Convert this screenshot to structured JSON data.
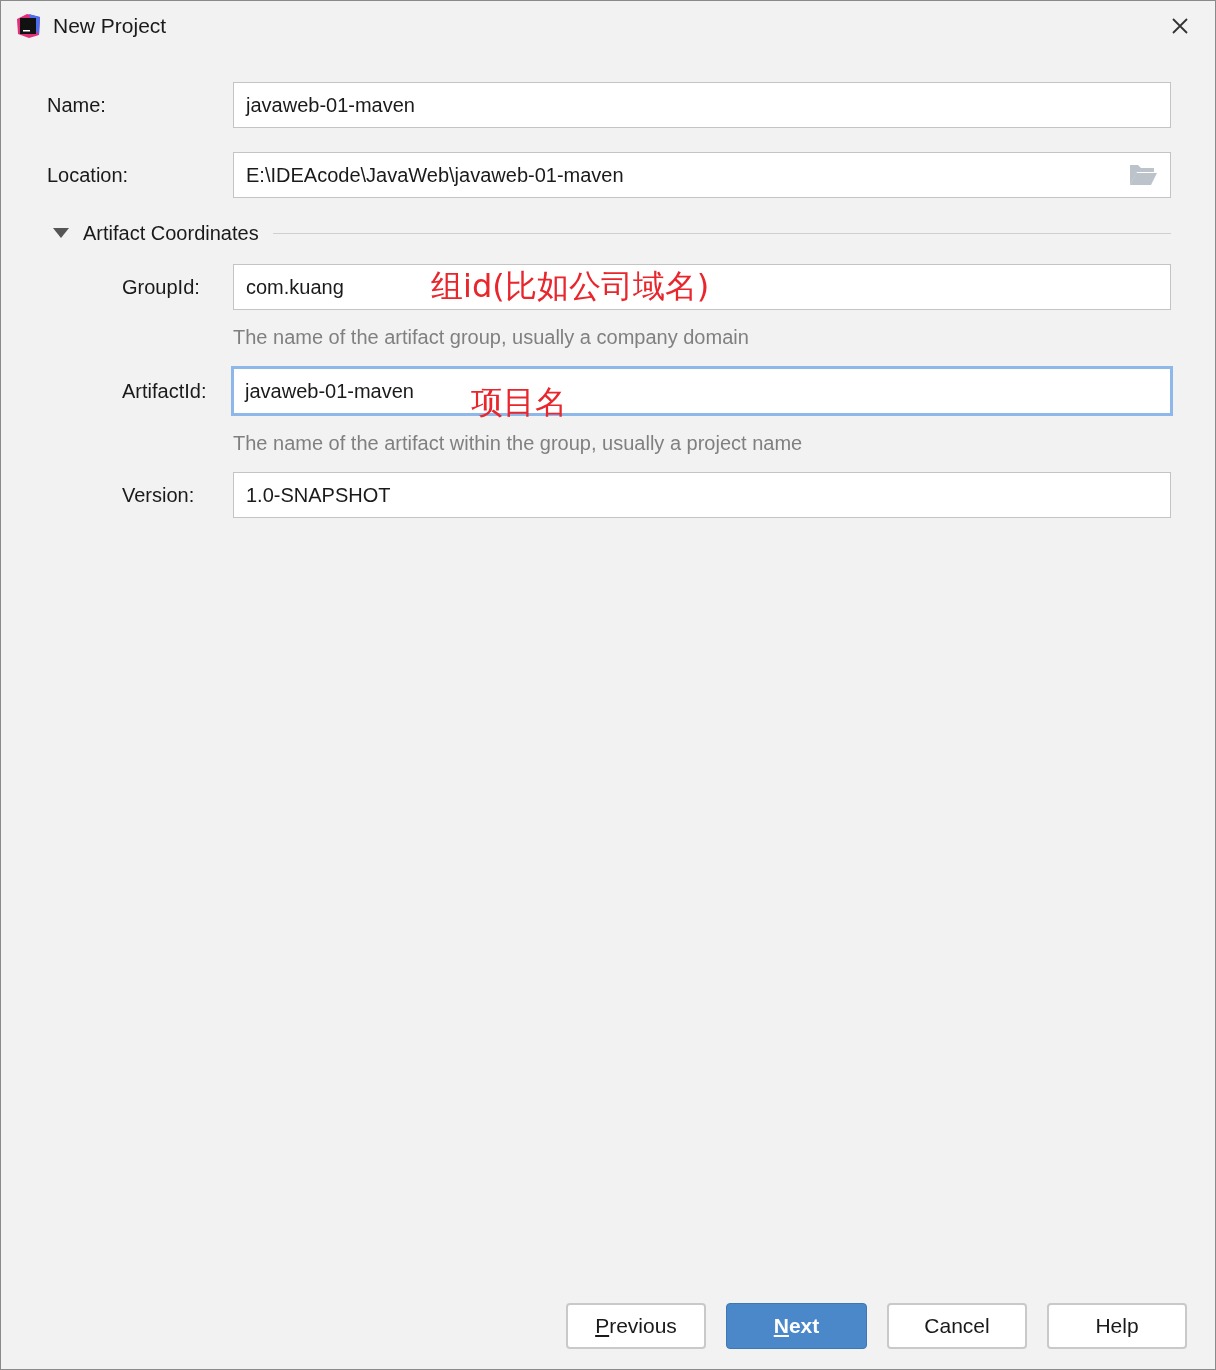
{
  "window": {
    "title": "New Project"
  },
  "fields": [
    {
      "label": "Name:",
      "value": "javaweb-01-maven",
      "browse": false
    },
    {
      "label": "Location:",
      "value": "E:\\IDEAcode\\JavaWeb\\javaweb-01-maven",
      "browse": true
    }
  ],
  "section": {
    "title": "Artifact Coordinates",
    "expanded": true,
    "fields": [
      {
        "label": "GroupId:",
        "value": "com.kuang",
        "focused": false,
        "hint": "The name of the artifact group, usually a company domain",
        "annotation": "组id(比如公司域名)"
      },
      {
        "label": "ArtifactId:",
        "value": "javaweb-01-maven",
        "focused": true,
        "hint": "The name of the artifact within the group, usually a project name",
        "annotation": "项目名"
      },
      {
        "label": "Version:",
        "value": "1.0-SNAPSHOT",
        "focused": false
      }
    ]
  },
  "buttons": [
    {
      "label": "Previous",
      "mnemonic": true,
      "primary": false
    },
    {
      "label": "Next",
      "mnemonic": true,
      "primary": true
    },
    {
      "label": "Cancel",
      "mnemonic": false,
      "primary": false
    },
    {
      "label": "Help",
      "mnemonic": false,
      "primary": false
    }
  ]
}
